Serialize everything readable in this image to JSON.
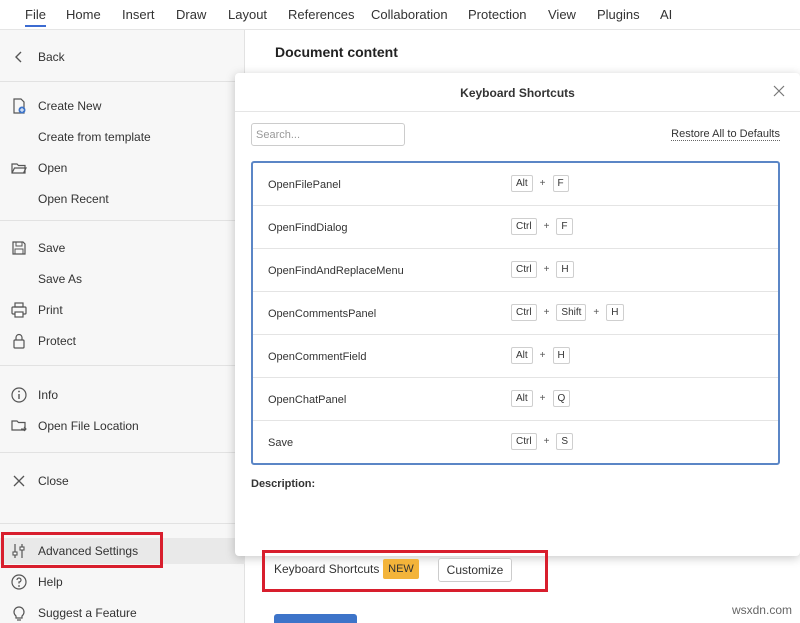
{
  "menu": {
    "tabs": [
      "File",
      "Home",
      "Insert",
      "Draw",
      "Layout",
      "References",
      "Collaboration",
      "Protection",
      "View",
      "Plugins",
      "AI"
    ]
  },
  "sidebar": {
    "back": "Back",
    "create_new": "Create New",
    "create_from_template": "Create from template",
    "open": "Open",
    "open_recent": "Open Recent",
    "save": "Save",
    "save_as": "Save As",
    "print": "Print",
    "protect": "Protect",
    "info": "Info",
    "open_file_location": "Open File Location",
    "close": "Close",
    "advanced_settings": "Advanced Settings",
    "help": "Help",
    "suggest_feature": "Suggest a Feature"
  },
  "main": {
    "doc_title": "Document content",
    "keyboard_shortcuts_label": "Keyboard Shortcuts",
    "new_badge": "NEW",
    "customize": "Customize"
  },
  "dialog": {
    "title": "Keyboard Shortcuts",
    "search_placeholder": "Search...",
    "restore": "Restore All to Defaults",
    "description_label": "Description:",
    "shortcuts": [
      {
        "name": "OpenFilePanel",
        "keys": [
          "Alt",
          "F"
        ]
      },
      {
        "name": "OpenFindDialog",
        "keys": [
          "Ctrl",
          "F"
        ]
      },
      {
        "name": "OpenFindAndReplaceMenu",
        "keys": [
          "Ctrl",
          "H"
        ]
      },
      {
        "name": "OpenCommentsPanel",
        "keys": [
          "Ctrl",
          "Shift",
          "H"
        ]
      },
      {
        "name": "OpenCommentField",
        "keys": [
          "Alt",
          "H"
        ]
      },
      {
        "name": "OpenChatPanel",
        "keys": [
          "Alt",
          "Q"
        ]
      },
      {
        "name": "Save",
        "keys": [
          "Ctrl",
          "S"
        ]
      }
    ],
    "plus": "+"
  },
  "watermark": "wsxdn.com",
  "colors": {
    "accent": "#3c6bd1",
    "highlight_box": "#d81e2d",
    "badge": "#f3b43a",
    "list_border": "#5b86c6"
  }
}
